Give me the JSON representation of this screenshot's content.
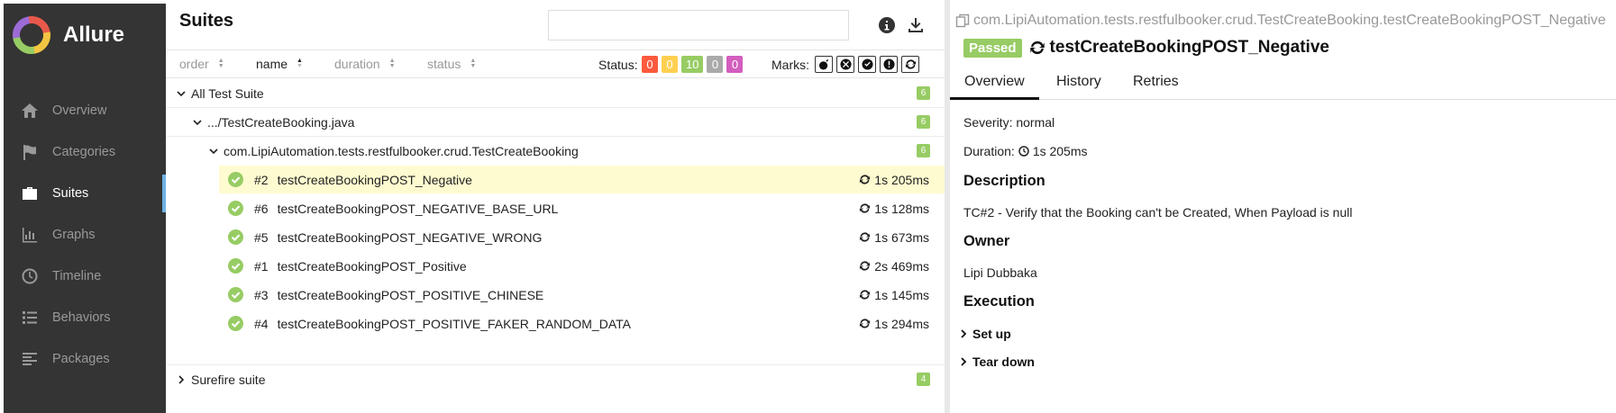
{
  "app": {
    "name": "Allure"
  },
  "sidebar": {
    "items": [
      {
        "label": "Overview",
        "icon": "home-icon",
        "active": false
      },
      {
        "label": "Categories",
        "icon": "flag-icon",
        "active": false
      },
      {
        "label": "Suites",
        "icon": "briefcase-icon",
        "active": true
      },
      {
        "label": "Graphs",
        "icon": "bar-chart-icon",
        "active": false
      },
      {
        "label": "Timeline",
        "icon": "clock-icon",
        "active": false
      },
      {
        "label": "Behaviors",
        "icon": "list-icon",
        "active": false
      },
      {
        "label": "Packages",
        "icon": "align-left-icon",
        "active": false
      }
    ]
  },
  "suites": {
    "title": "Suites",
    "search_value": "",
    "sort": {
      "order": "order",
      "name": "name",
      "duration": "duration",
      "status": "status"
    },
    "status_label": "Status:",
    "status_counts": [
      {
        "value": "0",
        "color": "#fd5a3e",
        "name": "failed"
      },
      {
        "value": "0",
        "color": "#ffd050",
        "name": "broken"
      },
      {
        "value": "10",
        "color": "#97cc64",
        "name": "passed"
      },
      {
        "value": "0",
        "color": "#aaaaaa",
        "name": "skipped"
      },
      {
        "value": "0",
        "color": "#d35ebe",
        "name": "unknown"
      }
    ],
    "marks_label": "Marks:",
    "tree": {
      "root": {
        "label": "All Test Suite",
        "count": "6"
      },
      "file": {
        "label": ".../TestCreateBooking.java",
        "count": "6"
      },
      "class": {
        "label": "com.LipiAutomation.tests.restfulbooker.crud.TestCreateBooking",
        "count": "6"
      },
      "tests": [
        {
          "num": "#2",
          "name": "testCreateBookingPOST_Negative",
          "time": "1s 205ms"
        },
        {
          "num": "#6",
          "name": "testCreateBookingPOST_NEGATIVE_BASE_URL",
          "time": "1s 128ms"
        },
        {
          "num": "#5",
          "name": "testCreateBookingPOST_NEGATIVE_WRONG",
          "time": "1s 673ms"
        },
        {
          "num": "#1",
          "name": "testCreateBookingPOST_Positive",
          "time": "2s 469ms"
        },
        {
          "num": "#3",
          "name": "testCreateBookingPOST_POSITIVE_CHINESE",
          "time": "1s 145ms"
        },
        {
          "num": "#4",
          "name": "testCreateBookingPOST_POSITIVE_FAKER_RANDOM_DATA",
          "time": "1s 294ms"
        }
      ],
      "other": {
        "label": "Surefire suite",
        "count": "4"
      }
    }
  },
  "detail": {
    "breadcrumb": "com.LipiAutomation.tests.restfulbooker.crud.TestCreateBooking.testCreateBookingPOST_Negative",
    "status": "Passed",
    "title": "testCreateBookingPOST_Negative",
    "tabs": [
      "Overview",
      "History",
      "Retries"
    ],
    "severity": "Severity: normal",
    "duration_label": "Duration:",
    "duration_value": "1s 205ms",
    "description_heading": "Description",
    "description": "TC#2 - Verify that the Booking can't be Created, When Payload is null",
    "owner_heading": "Owner",
    "owner": "Lipi Dubbaka",
    "execution_heading": "Execution",
    "setup": "Set up",
    "teardown": "Tear down"
  }
}
